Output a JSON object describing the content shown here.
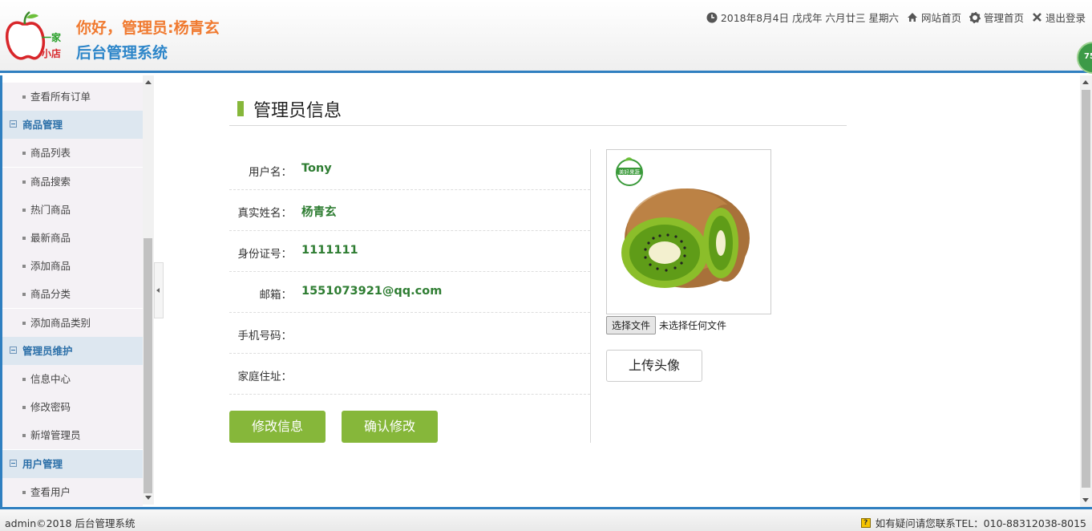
{
  "header": {
    "logo_text_top": "一家",
    "logo_text_bottom": "小店",
    "greeting": "你好，管理员:杨青玄",
    "system_title": "后台管理系统",
    "date_text": "2018年8月4日 戊戌年 六月廿三 星期六",
    "site_home": "网站首页",
    "admin_home": "管理首页",
    "logout": "退出登录",
    "badge": "75"
  },
  "sidebar": {
    "items": [
      {
        "type": "sub",
        "label": "查看所有订单"
      },
      {
        "type": "group",
        "label": "商品管理"
      },
      {
        "type": "sub",
        "label": "商品列表"
      },
      {
        "type": "sub",
        "label": "商品搜索"
      },
      {
        "type": "sub",
        "label": "热门商品"
      },
      {
        "type": "sub",
        "label": "最新商品"
      },
      {
        "type": "sub",
        "label": "添加商品"
      },
      {
        "type": "sub",
        "label": "商品分类"
      },
      {
        "type": "sub",
        "label": "添加商品类别"
      },
      {
        "type": "group",
        "label": "管理员维护"
      },
      {
        "type": "sub",
        "label": "信息中心"
      },
      {
        "type": "sub",
        "label": "修改密码"
      },
      {
        "type": "sub",
        "label": "新增管理员"
      },
      {
        "type": "group",
        "label": "用户管理"
      },
      {
        "type": "sub",
        "label": "查看用户"
      }
    ]
  },
  "main": {
    "title": "管理员信息",
    "fields": [
      {
        "label": "用户名：",
        "value": "Tony"
      },
      {
        "label": "真实姓名：",
        "value": "杨青玄"
      },
      {
        "label": "身份证号：",
        "value": "1111111"
      },
      {
        "label": "邮箱：",
        "value": "1551073921@qq.com"
      },
      {
        "label": "手机号码：",
        "value": ""
      },
      {
        "label": "家庭住址：",
        "value": ""
      }
    ],
    "edit_button": "修改信息",
    "confirm_button": "确认修改",
    "avatar_logo_text": "美好果蔬",
    "file_button": "选择文件",
    "file_status": "未选择任何文件",
    "upload_button": "上传头像"
  },
  "footer": {
    "left": "admin©2018 后台管理系统",
    "right": "如有疑问请您联系TEL：010-88312038-8015"
  },
  "colors": {
    "accent_blue": "#2f7fc0",
    "accent_green": "#86b73a",
    "value_green": "#2e7d32",
    "greeting_orange": "#f07a30"
  }
}
